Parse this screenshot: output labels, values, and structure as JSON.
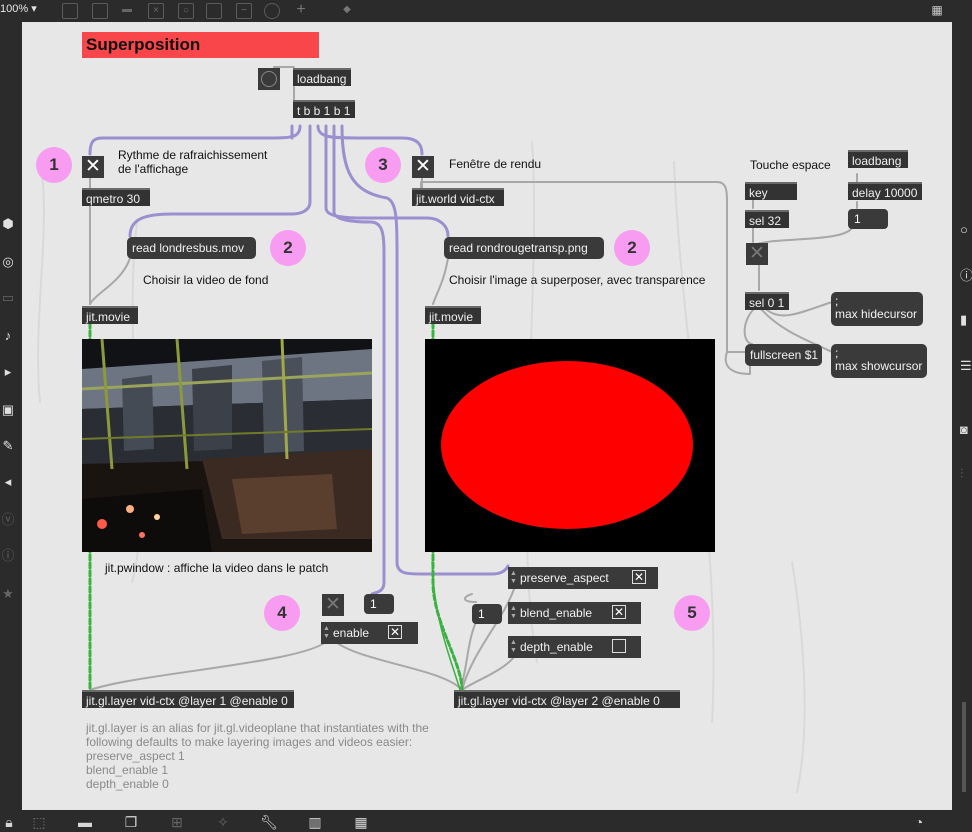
{
  "toolbar": {
    "zoom": "100%",
    "zoom_arrow": "▾"
  },
  "patch": {
    "title": "Superposition",
    "objects": {
      "loadbang1": "loadbang",
      "trigger": "t b b 1 b 1",
      "qmetro": "qmetro 30",
      "jitworld": "jit.world vid-ctx",
      "movie1": "jit.movie",
      "movie2": "jit.movie",
      "key": "key",
      "sel32": "sel 32",
      "loadbang2": "loadbang",
      "delay": "delay 10000",
      "sel01": "sel 0 1",
      "layer1": "jit.gl.layer vid-ctx @layer 1 @enable 0",
      "layer2": "jit.gl.layer vid-ctx @layer 2 @enable 0"
    },
    "messages": {
      "read1": "read londresbus.mov",
      "read2": "read rondrougetransp.png",
      "fullscreen": "fullscreen $1",
      "hide": ";\nmax hidecursor",
      "show": ";\nmax showcursor"
    },
    "numbers": {
      "n_delay": "1",
      "n_enable": "1",
      "n_blend": "1"
    },
    "toggles": {
      "t1": "✕",
      "t3": "✕",
      "t_space": "✕",
      "t4": "✕"
    },
    "comments": {
      "c1": "Rythme de rafraichissement\nde l'affichage",
      "c3": "Fenêtre de rendu",
      "c_read1": "Choisir la video de fond",
      "c_read2": "Choisir l'image a superposer, avec transparence",
      "c_space": "Touche espace",
      "c_pwin": "jit.pwindow : affiche la video dans le patch",
      "c_note": "jit.gl.layer is an alias for jit.gl.videoplane that instantiates with the\nfollowing defaults to make layering images and videos easier:\npreserve_aspect 1\nblend_enable 1\ndepth_enable 0"
    },
    "badges": {
      "b1": "1",
      "b2a": "2",
      "b2b": "2",
      "b3": "3",
      "b4": "4",
      "b5": "5"
    },
    "attrui": {
      "enable": {
        "label": "enable",
        "check": "✕",
        "checked": true
      },
      "preserve": {
        "label": "preserve_aspect",
        "check": "✕",
        "checked": true
      },
      "blend": {
        "label": "blend_enable",
        "check": "✕",
        "checked": true
      },
      "depth": {
        "label": "depth_enable",
        "check": "",
        "checked": false
      }
    },
    "colors": {
      "title_bg": "#f9464b",
      "badge": "#f79cf0",
      "canvas": "#e7e7e7",
      "patch_cord_matrix": "#3cb043",
      "patch_cord_purple": "#9b8fd0"
    }
  }
}
